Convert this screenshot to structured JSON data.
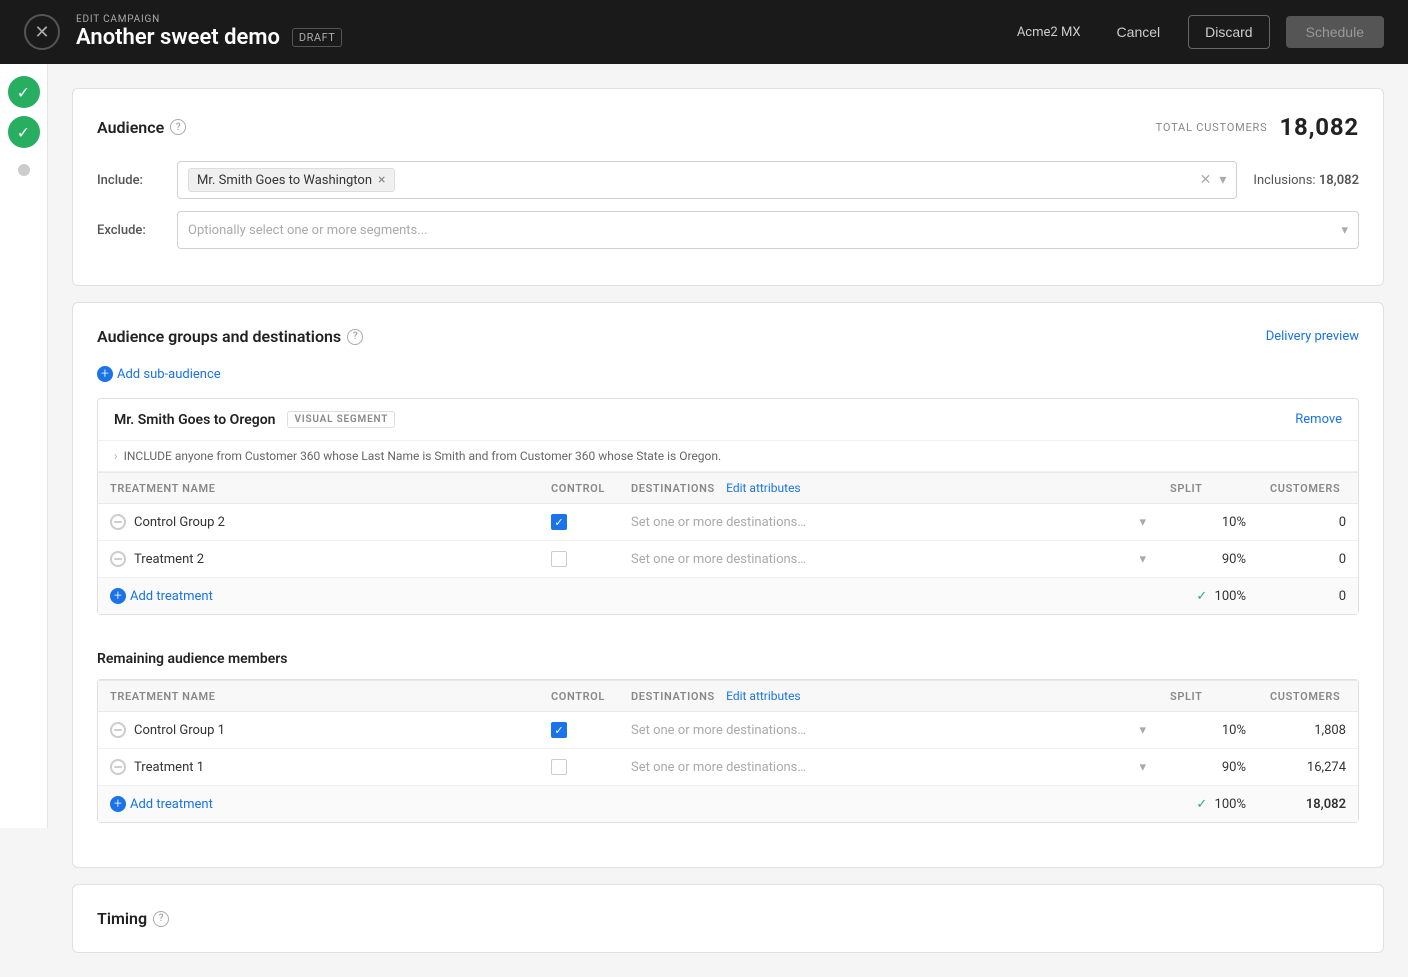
{
  "header": {
    "edit_label": "EDIT CAMPAIGN",
    "campaign_name": "Another sweet demo",
    "status_badge": "DRAFT",
    "account": "Acme2 MX",
    "cancel_label": "Cancel",
    "discard_label": "Discard",
    "schedule_label": "Schedule"
  },
  "audience_section": {
    "title": "Audience",
    "total_customers_label": "TOTAL CUSTOMERS",
    "total_customers_value": "18,082",
    "include_label": "Include:",
    "segment_tag": "Mr. Smith Goes to Washington",
    "inclusions_label": "Inclusions:",
    "inclusions_value": "18,082",
    "exclude_label": "Exclude:",
    "exclude_placeholder": "Optionally select one or more segments..."
  },
  "audience_groups_section": {
    "title": "Audience groups and destinations",
    "delivery_preview_label": "Delivery preview",
    "add_sub_audience_label": "Add sub-audience",
    "sub_audience": {
      "name": "Mr. Smith Goes to Oregon",
      "badge": "VISUAL SEGMENT",
      "remove_label": "Remove",
      "rule": "INCLUDE anyone from Customer 360 whose Last Name is Smith and from Customer 360 whose State is Oregon.",
      "treatments": [
        {
          "name": "Control Group 2",
          "control": true,
          "destination_placeholder": "Set one or more destinations…",
          "split": "10%",
          "customers": "0"
        },
        {
          "name": "Treatment 2",
          "control": false,
          "destination_placeholder": "Set one or more destinations…",
          "split": "90%",
          "customers": "0"
        }
      ],
      "add_treatment_label": "Add treatment",
      "total_split": "100%",
      "total_customers": "0"
    },
    "remaining_members": {
      "title": "Remaining audience members",
      "treatments": [
        {
          "name": "Control Group 1",
          "control": true,
          "destination_placeholder": "Set one or more destinations…",
          "split": "10%",
          "customers": "1,808"
        },
        {
          "name": "Treatment 1",
          "control": false,
          "destination_placeholder": "Set one or more destinations…",
          "split": "90%",
          "customers": "16,274"
        }
      ],
      "add_treatment_label": "Add treatment",
      "total_split": "100%",
      "total_customers": "18,082"
    }
  },
  "timing_section": {
    "title": "Timing"
  },
  "table_headers": {
    "treatment_name": "TREATMENT NAME",
    "control": "CONTROL",
    "destinations": "DESTINATIONS",
    "edit_attributes": "Edit attributes",
    "split": "SPLIT",
    "customers": "CUSTOMERS"
  }
}
